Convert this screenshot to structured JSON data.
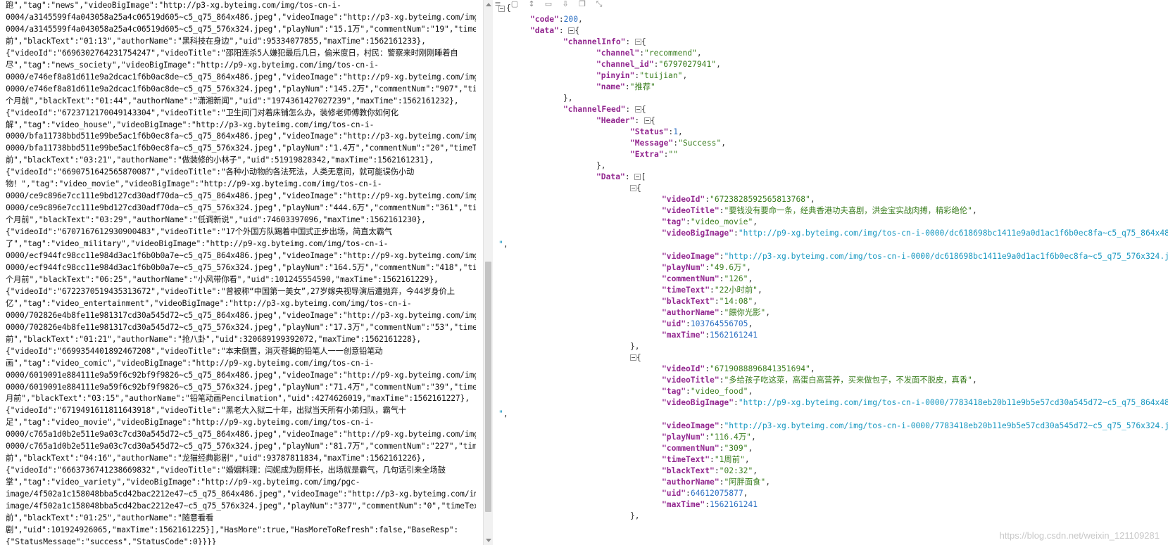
{
  "left": {
    "lines": [
      "跑\",\"tag\":\"news\",\"videoBigImage\":\"http://p3-xg.byteimg.com/img/tos-cn-i-",
      "0004/a3145599f4a043058a25a4c06519d605~c5_q75_864x486.jpeg\",\"videoImage\":\"http://p3-xg.byteimg.com/img/tos-cn-i-",
      "0004/a3145599f4a043058a25a4c06519d605~c5_q75_576x324.jpeg\",\"playNum\":\"15.1万\",\"commentNum\":\"19\",\"timeText\":\"2天",
      "前\",\"blackText\":\"01:13\",\"authorName\":\"黑科技在身边\",\"uid\":95334077855,\"maxTime\":1562161233},",
      "{\"videoId\":\"6696302764231754247\",\"videoTitle\":\"邵阳连杀5人嫌犯最后几日，偷米度日，村民：警察来时刚刚睡着自",
      "尽\",\"tag\":\"news_society\",\"videoBigImage\":\"http://p9-xg.byteimg.com/img/tos-cn-i-",
      "0000/e746ef8a81d611e9a2dcac1f6b0ac8de~c5_q75_864x486.jpeg\",\"videoImage\":\"http://p9-xg.byteimg.com/img/tos-cn-i-",
      "0000/e746ef8a81d611e9a2dcac1f6b0ac8de~c5_q75_576x324.jpeg\",\"playNum\":\"145.2万\",\"commentNum\":\"907\",\"timeText\":\"2",
      "个月前\",\"blackText\":\"01:44\",\"authorName\":\"潇湘新闻\",\"uid\":\"1974361427027239\",\"maxTime\":1562161232},",
      "{\"videoId\":\"6723712170049143304\",\"videoTitle\":\"卫生间门对着床铺怎么办，装修老师傅教你如何化",
      "解\",\"tag\":\"video_house\",\"videoBigImage\":\"http://p3-xg.byteimg.com/img/tos-cn-i-",
      "0000/bfa11738bbd511e99be5ac1f6b0ec8fa~c5_q75_864x486.jpeg\",\"videoImage\":\"http://p3-xg.byteimg.com/img/tos-cn-i-",
      "0000/bfa11738bbd511e99be5ac1f6b0ec8fa~c5_q75_576x324.jpeg\",\"playNum\":\"1.4万\",\"commentNum\":\"20\",\"timeText\":\"1天",
      "前\",\"blackText\":\"03:21\",\"authorName\":\"做装修的小林子\",\"uid\":51919828342,\"maxTime\":1562161231},",
      "{\"videoId\":\"6690751642565870087\",\"videoTitle\":\"各种小动物的各法死法，人类无意间，就可能误伤小动",
      "物！\",\"tag\":\"video_movie\",\"videoBigImage\":\"http://p9-xg.byteimg.com/img/tos-cn-i-",
      "0000/ce9c896e7cc111e9bd127cd30adf70da~c5_q75_864x486.jpeg\",\"videoImage\":\"http://p9-xg.byteimg.com/img/tos-cn-i-",
      "0000/ce9c896e7cc111e9bd127cd30adf70da~c5_q75_576x324.jpeg\",\"playNum\":\"444.6万\",\"commentNum\":\"361\",\"timeText\":\"2",
      "个月前\",\"blackText\":\"03:29\",\"authorName\":\"低调新说\",\"uid\":74603397096,\"maxTime\":1562161230},",
      "{\"videoId\":\"6707167612930900483\",\"videoTitle\":\"17个外国方队踢着中国式正步出场，简直太霸气",
      "了\",\"tag\":\"video_military\",\"videoBigImage\":\"http://p9-xg.byteimg.com/img/tos-cn-i-",
      "0000/ecf944fc98cc11e984d3ac1f6b0b0a7e~c5_q75_864x486.jpeg\",\"videoImage\":\"http://p9-xg.byteimg.com/img/tos-cn-i-",
      "0000/ecf944fc98cc11e984d3ac1f6b0b0a7e~c5_q75_576x324.jpeg\",\"playNum\":\"164.5万\",\"commentNum\":\"418\",\"timeText\":\"1",
      "个月前\",\"blackText\":\"06:25\",\"authorName\":\"小风带你看\",\"uid\":101245554590,\"maxTime\":1562161229},",
      "{\"videoId\":\"6722370519435313672\",\"videoTitle\":\"曾被称“中国第一美女”,27岁嫁央视导演后遭抛弃，今44岁身价上",
      "亿\",\"tag\":\"video_entertainment\",\"videoBigImage\":\"http://p3-xg.byteimg.com/img/tos-cn-i-",
      "0000/702826e4b8fe11e981317cd30a545d72~c5_q75_864x486.jpeg\",\"videoImage\":\"http://p3-xg.byteimg.com/img/tos-cn-i-",
      "0000/702826e4b8fe11e981317cd30a545d72~c5_q75_576x324.jpeg\",\"playNum\":\"17.3万\",\"commentNum\":\"53\",\"timeText\":\"4天",
      "前\",\"blackText\":\"01:21\",\"authorName\":\"抢八卦\",\"uid\":320689199392072,\"maxTime\":1562161228},",
      "{\"videoId\":\"6699354401892467208\",\"videoTitle\":\"本末倒置，消灭苍蝇的铅笔人一一创意铅笔动",
      "画\",\"tag\":\"video_comic\",\"videoBigImage\":\"http://p9-xg.byteimg.com/img/tos-cn-i-",
      "0000/6019091e884111e9a59f6c92bf9f9826~c5_q75_864x486.jpeg\",\"videoImage\":\"http://p9-xg.byteimg.com/img/tos-cn-i-",
      "0000/6019091e884111e9a59f6c92bf9f9826~c5_q75_576x324.jpeg\",\"playNum\":\"71.4万\",\"commentNum\":\"39\",\"timeText\":\"2个",
      "月前\",\"blackText\":\"03:15\",\"authorName\":\"铅笔动画Pencilmation\",\"uid\":4274626019,\"maxTime\":1562161227},",
      "{\"videoId\":\"6719491611811643918\",\"videoTitle\":\"黑老大入狱二十年，出狱当天所有小弟归队，霸气十",
      "足\",\"tag\":\"video_movie\",\"videoBigImage\":\"http://p9-xg.byteimg.com/img/tos-cn-i-",
      "0000/c765a1d0b2e511e9a03c7cd30a545d72~c5_q75_864x486.jpeg\",\"videoImage\":\"http://p9-xg.byteimg.com/img/tos-cn-i-",
      "0000/c765a1d0b2e511e9a03c7cd30a545d72~c5_q75_576x324.jpeg\",\"playNum\":\"81.7万\",\"commentNum\":\"227\",\"timeText\":\"1周",
      "前\",\"blackText\":\"04:16\",\"authorName\":\"龙猫经典影剧\",\"uid\":93787811834,\"maxTime\":1562161226},",
      "{\"videoId\":\"6663736741238669832\",\"videoTitle\":\"婚姻料理：闫妮成为厨师长，出场就是霸气，几句话引来全场鼓",
      "掌\",\"tag\":\"video_variety\",\"videoBigImage\":\"http://p9-xg.byteimg.com/img/pgc-",
      "image/4f502a1c158048bba5cd42bac2212e47~c5_q75_864x486.jpeg\",\"videoImage\":\"http://p3-xg.byteimg.com/img/pgc-",
      "image/4f502a1c158048bba5cd42bac2212e47~c5_q75_576x324.jpeg\",\"playNum\":\"377\",\"commentNum\":\"0\",\"timeText\":\"5个月",
      "前\",\"blackText\":\"01:25\",\"authorName\":\"随意看看",
      "剧\",\"uid\":101924926065,\"maxTime\":1562161225}],\"HasMore\":true,\"HasMoreToRefresh\":false,\"BaseResp\":",
      "{\"StatusMessage\":\"success\",\"StatusCode\":0}}}}"
    ]
  },
  "toolbar": {
    "icons": [
      "format-icon",
      "copy-icon",
      "sort-icon",
      "delete-icon",
      "download-icon",
      "duplicate-icon",
      "collapse-icon"
    ]
  },
  "json": {
    "code_key": "\"code\"",
    "code_val": "200",
    "data_key": "\"data\"",
    "channelInfo_key": "\"channelInfo\"",
    "channel_key": "\"channel\"",
    "channel_val": "\"recommend\"",
    "channel_id_key": "\"channel_id\"",
    "channel_id_val": "\"6797027941\"",
    "pinyin_key": "\"pinyin\"",
    "pinyin_val": "\"tuijian\"",
    "name_key": "\"name\"",
    "name_val": "\"推荐\"",
    "channelFeed_key": "\"channelFeed\"",
    "header_key": "\"Header\"",
    "status_key": "\"Status\"",
    "status_val": "1",
    "message_key": "\"Message\"",
    "message_val": "\"Success\"",
    "extra_key": "\"Extra\"",
    "extra_val": "\"\"",
    "data2_key": "\"Data\"",
    "items": [
      {
        "videoId": "\"6723828592565813768\"",
        "videoTitle": "\"要钱没有要命一条，经典香港功夫喜剧，洪金宝实战肉搏，精彩绝伦\"",
        "tag": "\"video_movie\"",
        "videoBigImage": "\"http://p9-xg.byteimg.com/img/tos-cn-i-0000/dc618698bc1411e9a0d1ac1f6b0ec8fa~c5_q75_864x486.jpeg",
        "videoImage": "\"http://p3-xg.byteimg.com/img/tos-cn-i-0000/dc618698bc1411e9a0d1ac1f6b0ec8fa~c5_q75_576x324.jpeg\"",
        "playNum": "\"49.6万\"",
        "commentNum": "\"126\"",
        "timeText": "\"22小时前\"",
        "blackText": "\"14:08\"",
        "authorName": "\"餵你光影\"",
        "uid": "103764556705",
        "maxTime": "1562161241"
      },
      {
        "videoId": "\"6719088896841351694\"",
        "videoTitle": "\"多给孩子吃这菜，高蛋白高营养，买来做包子，不发面不脱皮，真香\"",
        "tag": "\"video_food\"",
        "videoBigImage": "\"http://p9-xg.byteimg.com/img/tos-cn-i-0000/7783418eb20b11e9b5e57cd30a545d72~c5_q75_864x486.jpeg",
        "videoImage": "\"http://p3-xg.byteimg.com/img/tos-cn-i-0000/7783418eb20b11e9b5e57cd30a545d72~c5_q75_576x324.jpeg\"",
        "playNum": "\"116.4万\"",
        "commentNum": "\"309\"",
        "timeText": "\"1周前\"",
        "blackText": "\"02:32\"",
        "authorName": "\"阿胖面食\"",
        "uid": "64612075877",
        "maxTime": "1562161241"
      }
    ]
  },
  "watermark": "https://blog.csdn.net/weixin_121109281",
  "colors": {
    "key": "#92278f",
    "string": "#3a7d1e",
    "number": "#2a6ec2",
    "url": "#1797c0"
  }
}
